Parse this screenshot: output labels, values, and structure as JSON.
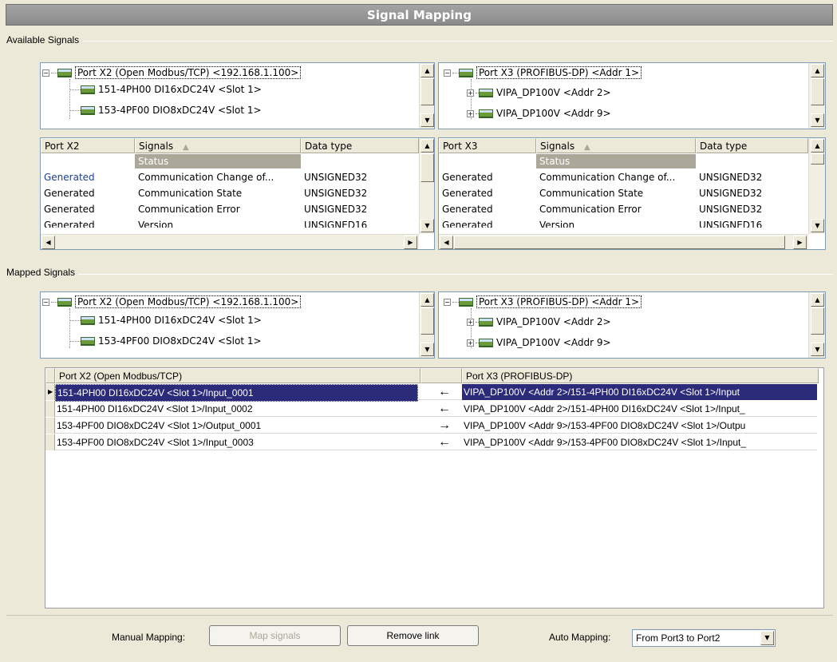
{
  "window": {
    "title": "Signal Mapping"
  },
  "available": {
    "group_label": "Available Signals",
    "left_tree": [
      {
        "toggle": "−",
        "label": "Port X2 (Open Modbus/TCP) <192.168.1.100>"
      },
      {
        "label": "151-4PH00 DI16xDC24V <Slot 1>"
      },
      {
        "label": "153-4PF00 DIO8xDC24V <Slot 1>"
      }
    ],
    "right_tree": [
      {
        "toggle": "−",
        "label": "Port X3 (PROFIBUS-DP) <Addr 1>"
      },
      {
        "toggle": "+",
        "label": "VIPA_DP100V <Addr 2>"
      },
      {
        "toggle": "+",
        "label": "VIPA_DP100V <Addr 9>"
      }
    ],
    "left_table": {
      "headers": [
        "Port X2",
        "Signals",
        "Data type"
      ],
      "sort_indicator": "▲",
      "group_row": "Status",
      "rows": [
        [
          "Generated",
          "Communication Change of...",
          "UNSIGNED32"
        ],
        [
          "Generated",
          "Communication State",
          "UNSIGNED32"
        ],
        [
          "Generated",
          "Communication Error",
          "UNSIGNED32"
        ],
        [
          "Generated",
          "Version",
          "UNSIGNED16"
        ]
      ]
    },
    "right_table": {
      "headers": [
        "Port X3",
        "Signals",
        "Data type"
      ],
      "sort_indicator": "▲",
      "group_row": "Status",
      "rows": [
        [
          "Generated",
          "Communication Change of...",
          "UNSIGNED32"
        ],
        [
          "Generated",
          "Communication State",
          "UNSIGNED32"
        ],
        [
          "Generated",
          "Communication Error",
          "UNSIGNED32"
        ],
        [
          "Generated",
          "Version",
          "UNSIGNED16"
        ]
      ]
    }
  },
  "mapped": {
    "group_label": "Mapped Signals",
    "left_tree": [
      {
        "toggle": "−",
        "label": "Port X2 (Open Modbus/TCP) <192.168.1.100>"
      },
      {
        "label": "151-4PH00 DI16xDC24V <Slot 1>"
      },
      {
        "label": "153-4PF00 DIO8xDC24V <Slot 1>"
      }
    ],
    "right_tree": [
      {
        "toggle": "−",
        "label": "Port X3 (PROFIBUS-DP) <Addr 1>"
      },
      {
        "toggle": "+",
        "label": "VIPA_DP100V <Addr 2>"
      },
      {
        "toggle": "+",
        "label": "VIPA_DP100V <Addr 9>"
      }
    ],
    "table": {
      "headers": [
        "Port X2 (Open Modbus/TCP)",
        "",
        "Port X3 (PROFIBUS-DP)"
      ],
      "rows": [
        {
          "left": "151-4PH00 DI16xDC24V <Slot 1>/Input_0001",
          "dir": "←",
          "right": "VIPA_DP100V <Addr 2>/151-4PH00 DI16xDC24V <Slot 1>/Input",
          "selected": true
        },
        {
          "left": "151-4PH00 DI16xDC24V <Slot 1>/Input_0002",
          "dir": "←",
          "right": "VIPA_DP100V <Addr 2>/151-4PH00 DI16xDC24V <Slot 1>/Input_",
          "selected": false
        },
        {
          "left": "153-4PF00 DIO8xDC24V <Slot 1>/Output_0001",
          "dir": "→",
          "right": "VIPA_DP100V <Addr 9>/153-4PF00 DIO8xDC24V <Slot 1>/Outpu",
          "selected": false
        },
        {
          "left": "153-4PF00 DIO8xDC24V <Slot 1>/Input_0003",
          "dir": "←",
          "right": "VIPA_DP100V <Addr 9>/153-4PF00 DIO8xDC24V <Slot 1>/Input_",
          "selected": false
        }
      ]
    }
  },
  "footer": {
    "manual_label": "Manual Mapping:",
    "map_button": "Map signals",
    "remove_button": "Remove link",
    "auto_label": "Auto Mapping:",
    "auto_value": "From Port3 to Port2"
  },
  "colors": {
    "selection": "#2b2b7a",
    "status_group": "#aca899",
    "generated_blue": "#1c3f94"
  }
}
